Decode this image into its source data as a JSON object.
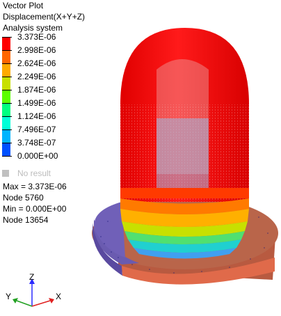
{
  "header": {
    "plot_type": "Vector Plot",
    "result": "Displacement(X+Y+Z)",
    "system": "Analysis system"
  },
  "legend": {
    "labels": [
      "3.373E-06",
      "2.998E-06",
      "2.624E-06",
      "2.249E-06",
      "1.874E-06",
      "1.499E-06",
      "1.124E-06",
      "7.496E-07",
      "3.748E-07",
      "0.000E+00"
    ],
    "colors": [
      "#ff0000",
      "#ff6600",
      "#ffaa00",
      "#c8e000",
      "#5cff00",
      "#00ff80",
      "#00ffd8",
      "#00b4ff",
      "#0050ff",
      "#0000c8"
    ],
    "no_result_label": "No result",
    "no_result_color": "#c0c0c0"
  },
  "stats": {
    "max": "Max = 3.373E-06",
    "max_node": "Node 5760",
    "min": "Min = 0.000E+00",
    "min_node": "Node 13654"
  },
  "triad": {
    "x": "X",
    "y": "Y",
    "z": "Z"
  }
}
